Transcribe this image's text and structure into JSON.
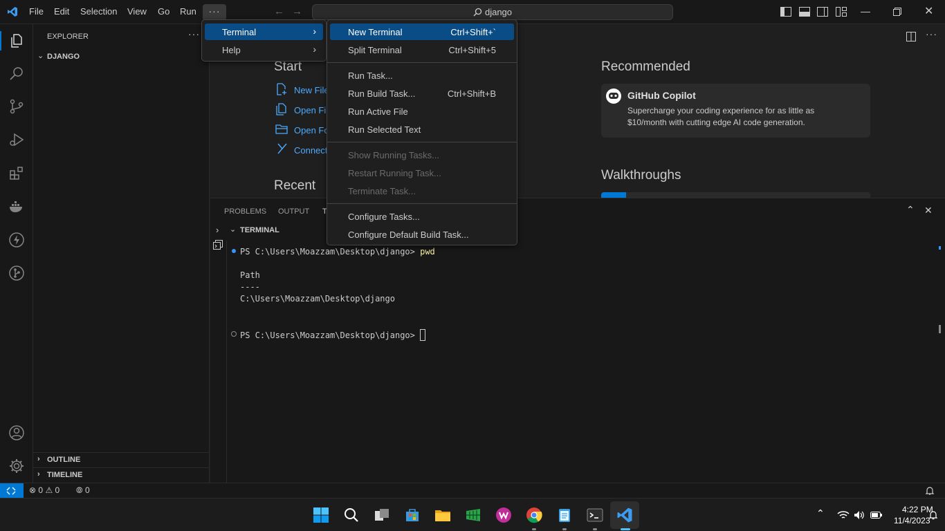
{
  "menubar": {
    "items": [
      "File",
      "Edit",
      "Selection",
      "View",
      "Go",
      "Run"
    ],
    "more": "···",
    "search": "django"
  },
  "sidebar": {
    "title": "EXPLORER",
    "more": "···",
    "folder": "DJANGO",
    "outline": "OUTLINE",
    "timeline": "TIMELINE"
  },
  "editor": {
    "start_heading": "Start",
    "start_links": [
      "New File...",
      "Open File...",
      "Open Folder...",
      "Connect to..."
    ],
    "recent_heading": "Recent",
    "recommended_heading": "Recommended",
    "copilot_title": "GitHub Copilot",
    "copilot_desc1": "Supercharge your coding experience for as little as",
    "copilot_desc2": "$10/month with cutting edge AI code generation.",
    "walkthroughs_heading": "Walkthroughs"
  },
  "panel": {
    "tabs": [
      "PROBLEMS",
      "OUTPUT",
      "T"
    ],
    "terminal_header": "TERMINAL",
    "lines": [
      {
        "prompt": "PS C:\\Users\\Moazzam\\Desktop\\django> ",
        "cmd": "pwd"
      },
      {
        "text": "Path"
      },
      {
        "text": "----"
      },
      {
        "text": "C:\\Users\\Moazzam\\Desktop\\django"
      },
      {
        "prompt": "PS C:\\Users\\Moazzam\\Desktop\\django> "
      }
    ]
  },
  "menu_more": {
    "items": [
      {
        "label": "Terminal",
        "active": true
      },
      {
        "label": "Help",
        "active": false
      }
    ]
  },
  "menu_terminal": {
    "items": [
      {
        "label": "New Terminal",
        "shortcut": "Ctrl+Shift+`",
        "state": "active"
      },
      {
        "label": "Split Terminal",
        "shortcut": "Ctrl+Shift+5",
        "state": "normal"
      },
      {
        "label": "Run Task...",
        "shortcut": "",
        "state": "normal"
      },
      {
        "label": "Run Build Task...",
        "shortcut": "Ctrl+Shift+B",
        "state": "normal"
      },
      {
        "label": "Run Active File",
        "shortcut": "",
        "state": "normal"
      },
      {
        "label": "Run Selected Text",
        "shortcut": "",
        "state": "normal"
      },
      {
        "label": "Show Running Tasks...",
        "shortcut": "",
        "state": "disabled"
      },
      {
        "label": "Restart Running Task...",
        "shortcut": "",
        "state": "disabled"
      },
      {
        "label": "Terminate Task...",
        "shortcut": "",
        "state": "disabled"
      },
      {
        "label": "Configure Tasks...",
        "shortcut": "",
        "state": "normal"
      },
      {
        "label": "Configure Default Build Task...",
        "shortcut": "",
        "state": "normal"
      }
    ]
  },
  "statusbar": {
    "errors": "0",
    "warnings": "0",
    "ports": "0"
  },
  "taskbar": {
    "time": "4:22 PM",
    "date": "11/4/2023"
  },
  "colors": {
    "accent": "#0078d4",
    "menu_active": "#0a4c86",
    "link": "#4daafc"
  }
}
